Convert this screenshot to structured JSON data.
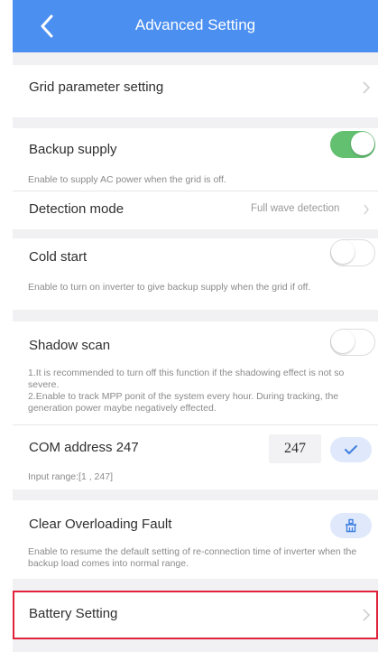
{
  "header": {
    "title": "Advanced Setting"
  },
  "rows": {
    "grid_param": {
      "label": "Grid  parameter setting"
    },
    "backup": {
      "label": "Backup supply",
      "desc": "Enable to supply AC power when the grid is off.",
      "enabled": true
    },
    "detection": {
      "label": "Detection mode",
      "value": "Full wave detection"
    },
    "cold_start": {
      "label": "Cold start",
      "desc": "Enable to turn on inverter to give backup supply when the grid if off.",
      "enabled": false
    },
    "shadow_scan": {
      "label": "Shadow scan",
      "desc_line1": "1.It is recommended to turn off this function if the shadowing effect is not so severe.",
      "desc_line2": "2.Enable to track MPP ponit of the system every hour. During tracking, the generation power maybe negatively effected.",
      "enabled": false
    },
    "com_address": {
      "label": "COM address 247",
      "value": "247",
      "range": "Input range:[1 , 247]"
    },
    "clear_fault": {
      "label": "Clear Overloading Fault",
      "desc": "Enable to resume the default setting of re-connection time of inverter when the backup load comes  into normal range."
    },
    "battery": {
      "label": "Battery Setting"
    }
  },
  "colors": {
    "header": "#4b8ff0",
    "toggle_on": "#63c071",
    "highlight": "#e0233b"
  },
  "icons": {
    "back": "chevron-left-icon",
    "chevron": "chevron-right-icon",
    "confirm": "checkmark-icon",
    "clear": "clear-icon"
  }
}
